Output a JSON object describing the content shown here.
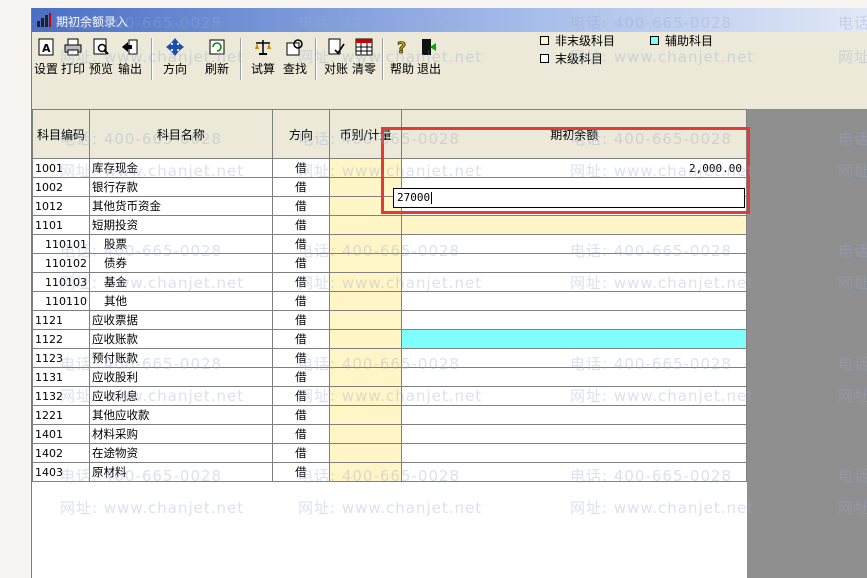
{
  "window": {
    "title": "期初余额录入"
  },
  "toolbar": {
    "buttons": [
      {
        "label": "设置",
        "icon": "settings-icon"
      },
      {
        "label": "打印",
        "icon": "printer-icon"
      },
      {
        "label": "预览",
        "icon": "preview-icon"
      },
      {
        "label": "输出",
        "icon": "export-icon"
      },
      {
        "label": "方向",
        "icon": "direction-icon"
      },
      {
        "label": "刷新",
        "icon": "refresh-icon"
      },
      {
        "label": "试算",
        "icon": "balance-scale-icon"
      },
      {
        "label": "查找",
        "icon": "find-icon"
      },
      {
        "label": "对账",
        "icon": "reconcile-icon"
      },
      {
        "label": "清零",
        "icon": "clear-icon"
      },
      {
        "label": "帮助",
        "icon": "help-icon"
      },
      {
        "label": "退出",
        "icon": "exit-icon"
      }
    ]
  },
  "legend": {
    "non_leaf": "非末级科目",
    "auxiliary": "辅助科目",
    "leaf": "末级科目",
    "aux_color": "#80ffff"
  },
  "table": {
    "headers": {
      "code": "科目编码",
      "name": "科目名称",
      "direction": "方向",
      "currency": "币别/计量",
      "balance": "期初余额"
    },
    "rows": [
      {
        "code": "1001",
        "name": "库存现金",
        "direction": "借",
        "balance": "2,000.00"
      },
      {
        "code": "1002",
        "name": "银行存款",
        "direction": "借",
        "balance": ""
      },
      {
        "code": "1012",
        "name": "其他货币资金",
        "direction": "借",
        "balance": ""
      },
      {
        "code": "1101",
        "name": "短期投资",
        "direction": "借",
        "balance": ""
      },
      {
        "code": "110101",
        "name": "股票",
        "direction": "借",
        "balance": ""
      },
      {
        "code": "110102",
        "name": "债券",
        "direction": "借",
        "balance": ""
      },
      {
        "code": "110103",
        "name": "基金",
        "direction": "借",
        "balance": ""
      },
      {
        "code": "110110",
        "name": "其他",
        "direction": "借",
        "balance": ""
      },
      {
        "code": "1121",
        "name": "应收票据",
        "direction": "借",
        "balance": ""
      },
      {
        "code": "1122",
        "name": "应收账款",
        "direction": "借",
        "balance": ""
      },
      {
        "code": "1123",
        "name": "预付账款",
        "direction": "借",
        "balance": ""
      },
      {
        "code": "1131",
        "name": "应收股利",
        "direction": "借",
        "balance": ""
      },
      {
        "code": "1132",
        "name": "应收利息",
        "direction": "借",
        "balance": ""
      },
      {
        "code": "1221",
        "name": "其他应收款",
        "direction": "借",
        "balance": ""
      },
      {
        "code": "1401",
        "name": "材料采购",
        "direction": "借",
        "balance": ""
      },
      {
        "code": "1402",
        "name": "在途物资",
        "direction": "借",
        "balance": ""
      },
      {
        "code": "1403",
        "name": "原材料",
        "direction": "借",
        "balance": ""
      }
    ]
  },
  "edit": {
    "value": "27000"
  },
  "watermark": {
    "phone": "电话: 400-665-0028",
    "site": "网址: www.chanjet.net"
  }
}
